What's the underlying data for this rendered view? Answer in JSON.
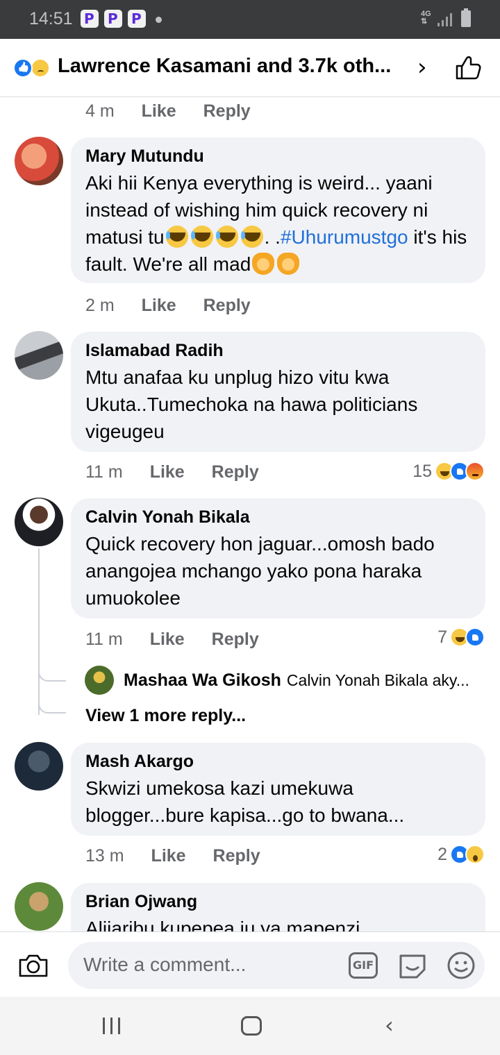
{
  "status_bar": {
    "time": "14:51",
    "network": "4G"
  },
  "header": {
    "title": "Lawrence Kasamani and 3.7k oth...",
    "reactions": [
      "like-icon",
      "sad-icon"
    ],
    "chevron_icon": "chevron-right-icon",
    "like_icon": "thumbs-up-icon"
  },
  "actions": {
    "like": "Like",
    "reply": "Reply"
  },
  "top_meta": {
    "time": "4 m"
  },
  "comments": [
    {
      "author": "Mary Mutundu",
      "text_before": "Aki hii Kenya everything is weird... yaani instead of wishing him quick recovery ni matusi tu",
      "text_mid": ". .",
      "hashtag": "#Uhurumustgo",
      "text_after": "it's his fault. We're all mad",
      "time": "2 m",
      "avatar_color": "#e0685a"
    },
    {
      "author": "Islamabad Radih",
      "text": "Mtu anafaa ku unplug hizo vitu kwa Ukuta..Tumechoka na hawa politicians vigeugeu",
      "time": "11 m",
      "reaction_count": "15",
      "reaction_types": [
        "haha",
        "like",
        "angry"
      ]
    },
    {
      "author": "Calvin Yonah Bikala",
      "text": "Quick recovery hon jaguar...omosh bado anangojea mchango yako pona haraka umuokolee",
      "time": "11 m",
      "reaction_count": "7",
      "reaction_types": [
        "haha",
        "like"
      ],
      "reply_preview": {
        "author": "Mashaa Wa Gikosh",
        "text": "Calvin Yonah Bikala aky..."
      },
      "view_more": "View 1 more reply..."
    },
    {
      "author": "Mash Akargo",
      "text": "Skwizi umekosa kazi umekuwa blogger...bure kapisa...go to bwana...",
      "time": "13 m",
      "reaction_count": "2",
      "reaction_types": [
        "like",
        "wow"
      ]
    },
    {
      "author": "Brian Ojwang",
      "text": "Alijaribu kupepea ju ya mapenzi..."
    }
  ],
  "composer": {
    "placeholder": "Write a comment...",
    "gif_label": "GIF",
    "icons": [
      "camera-icon",
      "gif-icon",
      "sticker-icon",
      "emoji-icon"
    ]
  },
  "nav": {
    "icons": [
      "recents-icon",
      "home-icon",
      "back-icon"
    ]
  }
}
